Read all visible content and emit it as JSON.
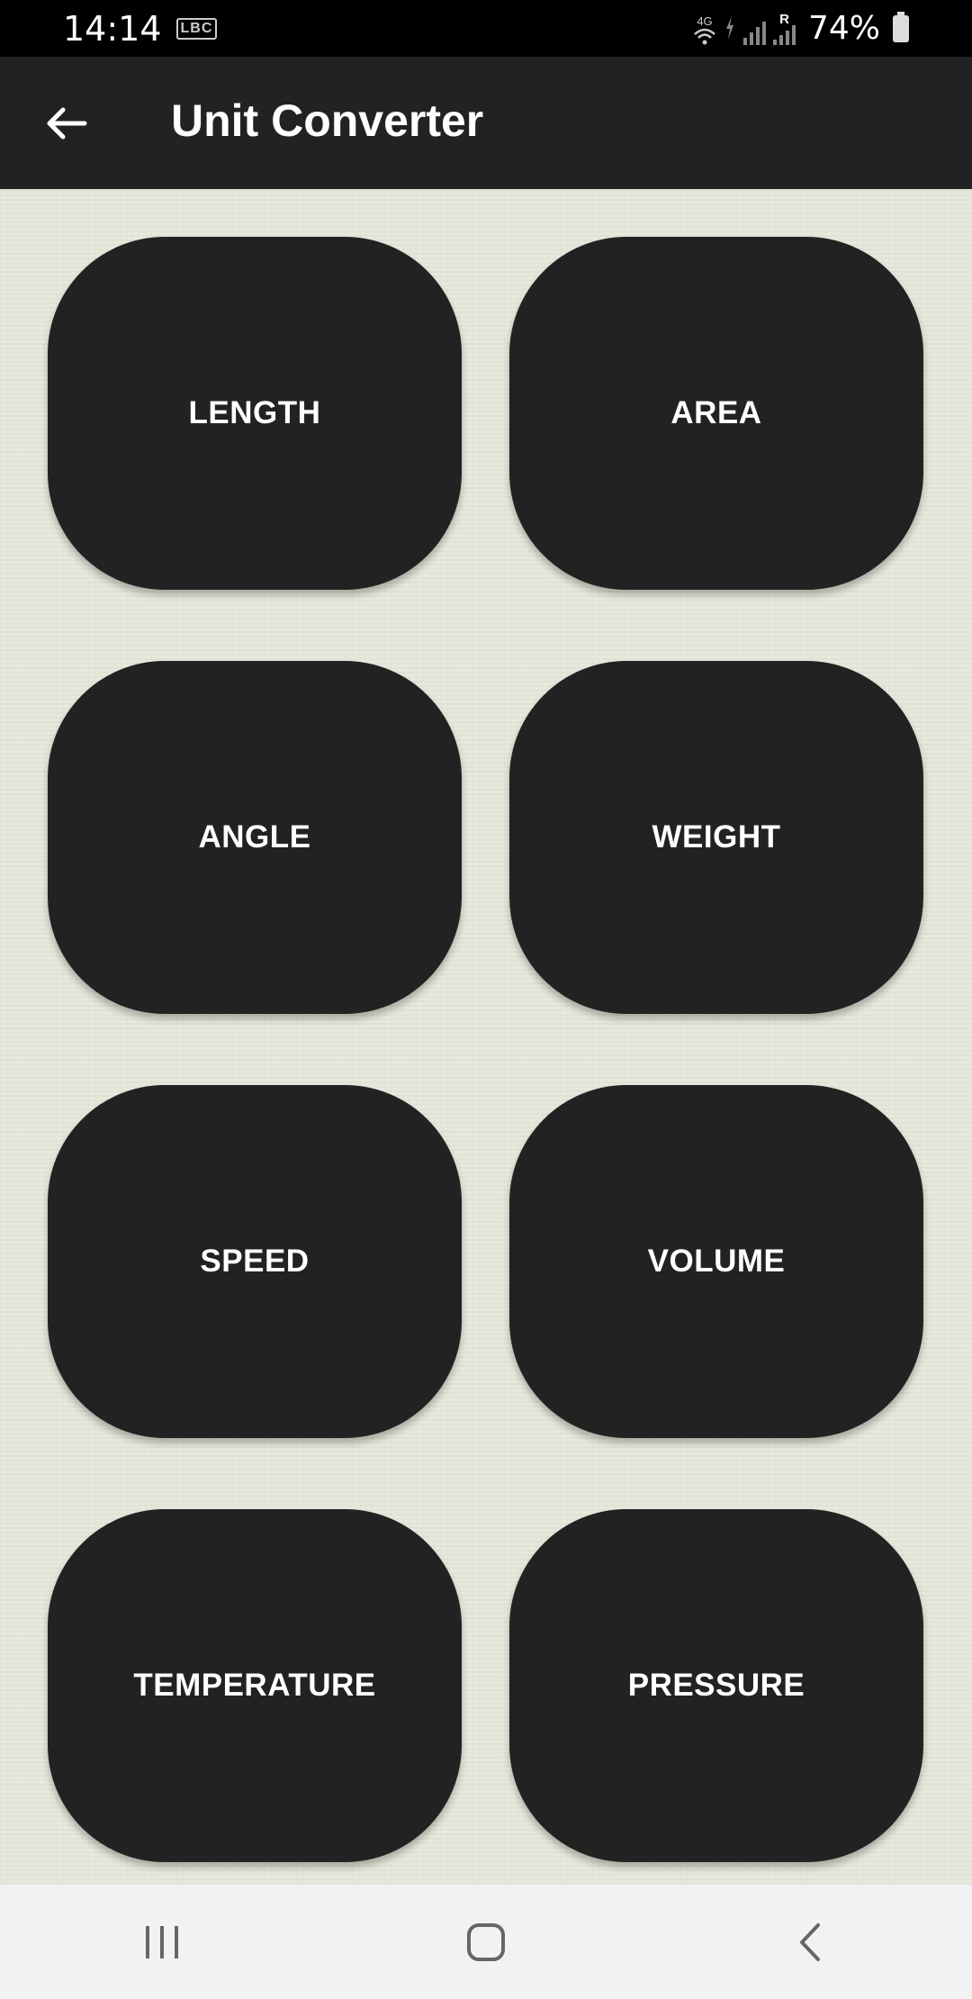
{
  "status_bar": {
    "time": "14:14",
    "carrier_badge": "LBC",
    "network_label": "4G",
    "roaming_label": "R",
    "battery_percent": "74%"
  },
  "app_bar": {
    "title": "Unit Converter",
    "back_icon": "arrow-left-icon"
  },
  "categories": [
    {
      "label": "LENGTH"
    },
    {
      "label": "AREA"
    },
    {
      "label": "ANGLE"
    },
    {
      "label": "WEIGHT"
    },
    {
      "label": "SPEED"
    },
    {
      "label": "VOLUME"
    },
    {
      "label": "TEMPERATURE"
    },
    {
      "label": "PRESSURE"
    }
  ],
  "nav_bar": {
    "recents_icon": "recents-icon",
    "home_icon": "home-icon",
    "back_icon": "nav-back-icon"
  },
  "colors": {
    "tile": "#222222",
    "app_bar": "#222222",
    "background": "#e7e7db"
  }
}
